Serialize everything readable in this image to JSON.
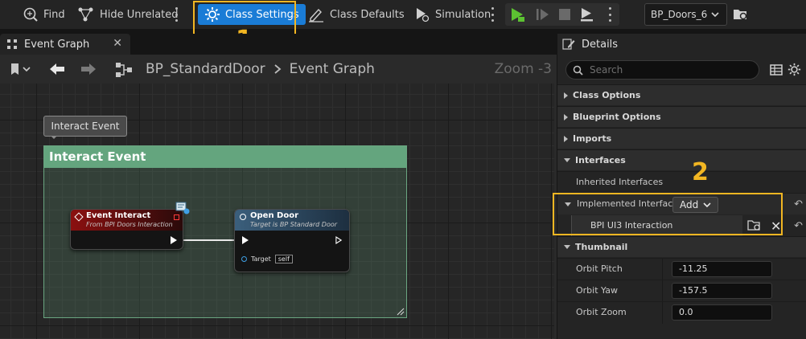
{
  "toolbar": {
    "find": "Find",
    "hide_unrelated": "Hide Unrelated",
    "class_settings": "Class Settings",
    "class_defaults": "Class Defaults",
    "simulation": "Simulation",
    "blueprint_select": "BP_Doors_6"
  },
  "graph": {
    "tab_title": "Event Graph",
    "breadcrumb": [
      "BP_StandardDoor",
      "Event Graph"
    ],
    "zoom": "Zoom -3",
    "comment_bubble": "Interact Event",
    "comment_title": "Interact Event",
    "nodes": {
      "event": {
        "title": "Event Interact",
        "subtitle": "From BPI Doors Interaction"
      },
      "open_door": {
        "title": "Open Door",
        "subtitle": "Target is BP Standard Door",
        "target_label": "Target",
        "target_value": "self"
      }
    }
  },
  "details": {
    "tab_title": "Details",
    "search_placeholder": "Search",
    "categories": {
      "class_options": "Class Options",
      "blueprint_options": "Blueprint Options",
      "imports": "Imports",
      "interfaces": "Interfaces",
      "thumbnail": "Thumbnail"
    },
    "inherited_interfaces": "Inherited Interfaces",
    "implemented_interfaces": "Implemented Interfac",
    "add_label": "Add",
    "interface_item": "BPI UI3 Interaction",
    "thumbnail": {
      "orbit_pitch_label": "Orbit Pitch",
      "orbit_pitch": "-11.25",
      "orbit_yaw_label": "Orbit Yaw",
      "orbit_yaw": "-157.5",
      "orbit_zoom_label": "Orbit Zoom",
      "orbit_zoom": "0.0"
    }
  },
  "annotations": {
    "step1": "1",
    "step2": "2"
  },
  "colors": {
    "accent": "#1a7cd6",
    "highlight": "#f2b622",
    "comment": "#64a57e",
    "event_node": "#8b1010",
    "function_node": "#3b5f7c"
  }
}
